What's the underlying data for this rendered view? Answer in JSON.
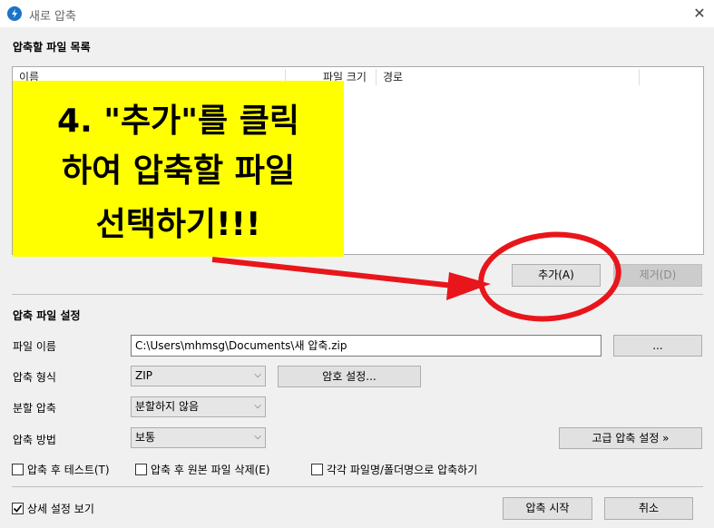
{
  "window": {
    "title": "새로 압축",
    "close_glyph": "✕"
  },
  "file_list": {
    "section_title": "압축할 파일 목록",
    "columns": [
      "이름",
      "파일 크기",
      "경로"
    ],
    "add_button": "추가(A)",
    "remove_button": "제거(D)"
  },
  "settings": {
    "section_title": "압축 파일 설정",
    "filename_label": "파일 이름",
    "filename_value": "C:\\Users\\mhmsg\\Documents\\새 압축.zip",
    "browse_button": "...",
    "format_label": "압축 형식",
    "format_value": "ZIP",
    "password_button": "암호 설정...",
    "split_label": "분할 압축",
    "split_value": "분할하지 않음",
    "method_label": "압축 방법",
    "method_value": "보통",
    "advanced_button": "고급 압축 설정 »",
    "test_after": "압축 후 테스트(T)",
    "delete_after": "압축 후 원본 파일 삭제(E)",
    "each_file": "각각 파일명/폴더명으로 압축하기"
  },
  "footer": {
    "details_label": "상세 설정 보기",
    "details_checked": true,
    "start_button": "압축 시작",
    "cancel_button": "취소"
  },
  "annotation": {
    "line1": "4. \"추가\"를 클릭",
    "line2": "하여 압축할 파일",
    "line3": "선택하기!!!",
    "highlight_color": "#ffff00",
    "arrow_color": "#e8161b"
  }
}
